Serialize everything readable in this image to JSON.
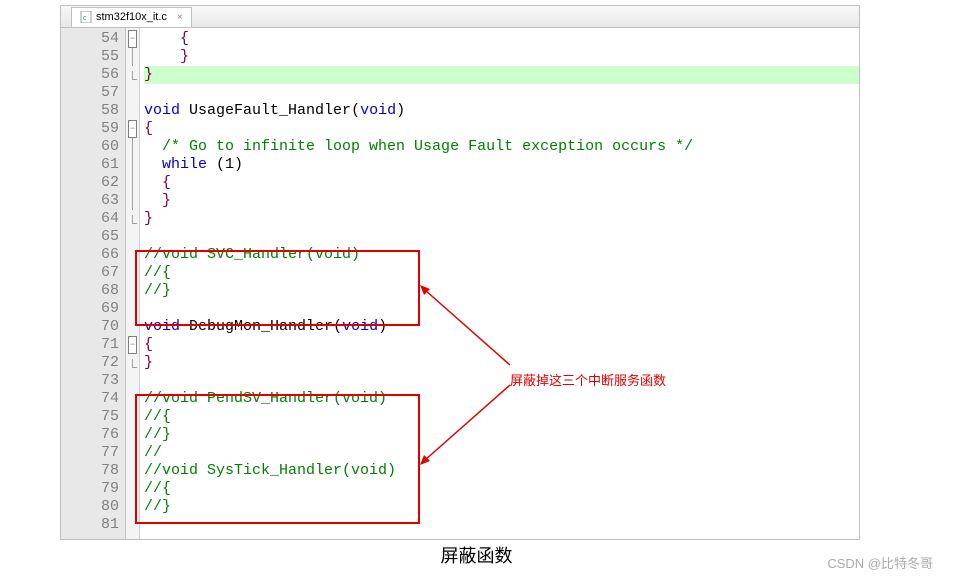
{
  "tab": {
    "filename": "stm32f10x_it.c"
  },
  "lines": [
    {
      "n": 54,
      "fold": "box-minus",
      "html": "    <span class='br'>{</span>"
    },
    {
      "n": 55,
      "fold": "line",
      "html": "    <span class='br'>}</span>"
    },
    {
      "n": 56,
      "fold": "corner",
      "highlight": true,
      "html": "<span class='br'>}</span>"
    },
    {
      "n": 57,
      "fold": "",
      "html": ""
    },
    {
      "n": 58,
      "fold": "",
      "html": "<span class='kw'>void</span> <span class='fn'>UsageFault_Handler</span>(<span class='kw'>void</span>)"
    },
    {
      "n": 59,
      "fold": "box-minus",
      "html": "<span class='br'>{</span>"
    },
    {
      "n": 60,
      "fold": "line",
      "html": "  <span class='cm'>/* Go to infinite loop when Usage Fault exception occurs */</span>"
    },
    {
      "n": 61,
      "fold": "line",
      "html": "  <span class='kw'>while</span> (1)"
    },
    {
      "n": 62,
      "fold": "line",
      "html": "  <span class='br'>{</span>"
    },
    {
      "n": 63,
      "fold": "line",
      "html": "  <span class='br'>}</span>"
    },
    {
      "n": 64,
      "fold": "corner",
      "html": "<span class='br'>}</span>"
    },
    {
      "n": 65,
      "fold": "",
      "html": ""
    },
    {
      "n": 66,
      "fold": "",
      "html": "<span class='cm'>//void SVC_Handler(void)</span>"
    },
    {
      "n": 67,
      "fold": "",
      "html": "<span class='cm'>//{</span>"
    },
    {
      "n": 68,
      "fold": "",
      "html": "<span class='cm'>//}</span>"
    },
    {
      "n": 69,
      "fold": "",
      "html": ""
    },
    {
      "n": 70,
      "fold": "",
      "html": "<span class='kw'>void</span> <span class='fn'>DebugMon_Handler</span>(<span class='kw'>void</span>)"
    },
    {
      "n": 71,
      "fold": "box-minus",
      "html": "<span class='br'>{</span>"
    },
    {
      "n": 72,
      "fold": "corner",
      "html": "<span class='br'>}</span>"
    },
    {
      "n": 73,
      "fold": "",
      "html": ""
    },
    {
      "n": 74,
      "fold": "",
      "html": "<span class='cm'>//void PendSV_Handler(void)</span>"
    },
    {
      "n": 75,
      "fold": "",
      "html": "<span class='cm'>//{</span>"
    },
    {
      "n": 76,
      "fold": "",
      "html": "<span class='cm'>//}</span>"
    },
    {
      "n": 77,
      "fold": "",
      "html": "<span class='cm'>//</span>"
    },
    {
      "n": 78,
      "fold": "",
      "html": "<span class='cm'>//void SysTick_Handler(void)</span>"
    },
    {
      "n": 79,
      "fold": "",
      "html": "<span class='cm'>//{</span>"
    },
    {
      "n": 80,
      "fold": "",
      "html": "<span class='cm'>//}</span>"
    },
    {
      "n": 81,
      "fold": "",
      "html": ""
    }
  ],
  "annotation": {
    "text": "屏蔽掉这三个中断服务函数"
  },
  "caption": "屏蔽函数",
  "watermark": "CSDN @比特冬哥"
}
